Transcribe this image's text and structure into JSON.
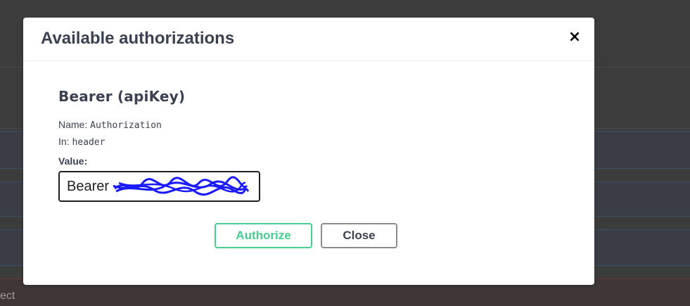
{
  "background": {
    "partial_text": "ect"
  },
  "modal": {
    "title": "Available authorizations",
    "close_glyph": "×",
    "close_icon": "close-icon",
    "scheme": {
      "title": "Bearer (apiKey)",
      "name_label": "Name:",
      "name_value": "Authorization",
      "in_label": "In:",
      "in_value": "header",
      "value_label": "Value:",
      "value_input": "Bearer "
    },
    "buttons": {
      "authorize_label": "Authorize",
      "close_label": "Close"
    }
  },
  "colors": {
    "authorize_accent": "#49cc90",
    "title_text": "#3b4151",
    "redaction_scribble": "#1a1aff",
    "backdrop": "#3c3c3c"
  }
}
